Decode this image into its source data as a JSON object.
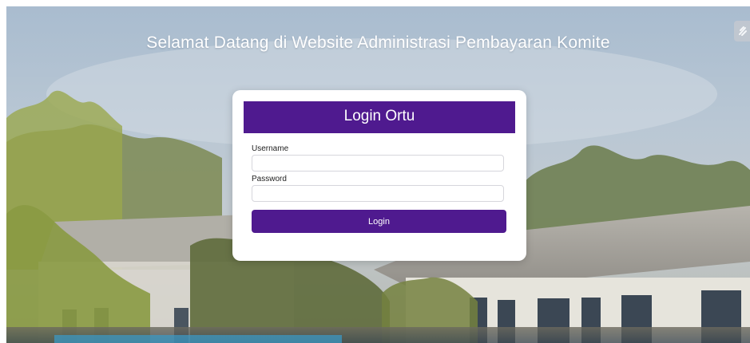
{
  "page": {
    "welcome_text": "Selamat Datang di Website Administrasi Pembayaran Komite"
  },
  "login": {
    "title": "Login Ortu",
    "username_label": "Username",
    "username_value": "",
    "password_label": "Password",
    "password_value": "",
    "submit_label": "Login"
  },
  "icons": {
    "corner": "floating-widget-icon",
    "background": "school-building-photo"
  },
  "colors": {
    "accent": "#4f1a8f",
    "card": "#ffffff",
    "text_on_accent": "#ffffff"
  }
}
